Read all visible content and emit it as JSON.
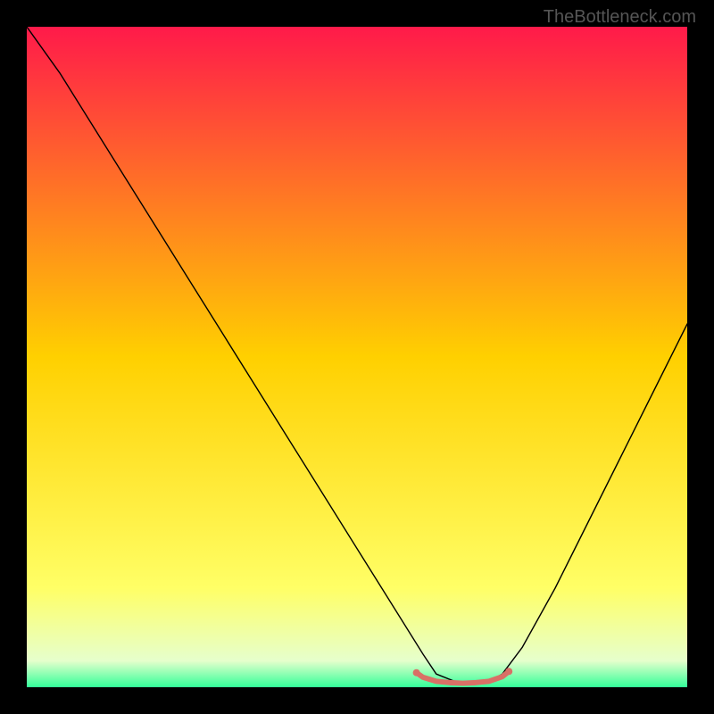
{
  "watermark": "TheBottleneck.com",
  "chart_data": {
    "type": "line",
    "title": "",
    "xlabel": "",
    "ylabel": "",
    "xlim": [
      0,
      100
    ],
    "ylim": [
      0,
      100
    ],
    "background_gradient": {
      "stops": [
        {
          "offset": 0,
          "color": "#ff1a4a"
        },
        {
          "offset": 50,
          "color": "#ffd000"
        },
        {
          "offset": 85,
          "color": "#ffff66"
        },
        {
          "offset": 96,
          "color": "#e6ffcc"
        },
        {
          "offset": 100,
          "color": "#33ff99"
        }
      ]
    },
    "series": [
      {
        "name": "bottleneck-curve",
        "color": "#000000",
        "width": 1.4,
        "x": [
          0,
          5,
          10,
          15,
          20,
          25,
          30,
          35,
          40,
          45,
          50,
          55,
          60,
          62,
          65,
          68,
          70,
          72,
          75,
          80,
          85,
          90,
          95,
          100
        ],
        "y": [
          100,
          93,
          85,
          77,
          69,
          61,
          53,
          45,
          37,
          29,
          21,
          13,
          5,
          2,
          0.8,
          0.6,
          0.8,
          2,
          6,
          15,
          25,
          35,
          45,
          55
        ]
      },
      {
        "name": "minimum-highlight",
        "color": "#d97066",
        "width": 6,
        "x": [
          59,
          60,
          62,
          64,
          66,
          68,
          70,
          72,
          73
        ],
        "y": [
          2.2,
          1.5,
          0.9,
          0.7,
          0.6,
          0.7,
          0.9,
          1.6,
          2.4
        ]
      }
    ],
    "markers": [
      {
        "name": "left-end-dot",
        "x": 59,
        "y": 2.2,
        "r": 4,
        "color": "#d97066"
      },
      {
        "name": "right-end-dot",
        "x": 73,
        "y": 2.4,
        "r": 4,
        "color": "#d97066"
      }
    ]
  }
}
